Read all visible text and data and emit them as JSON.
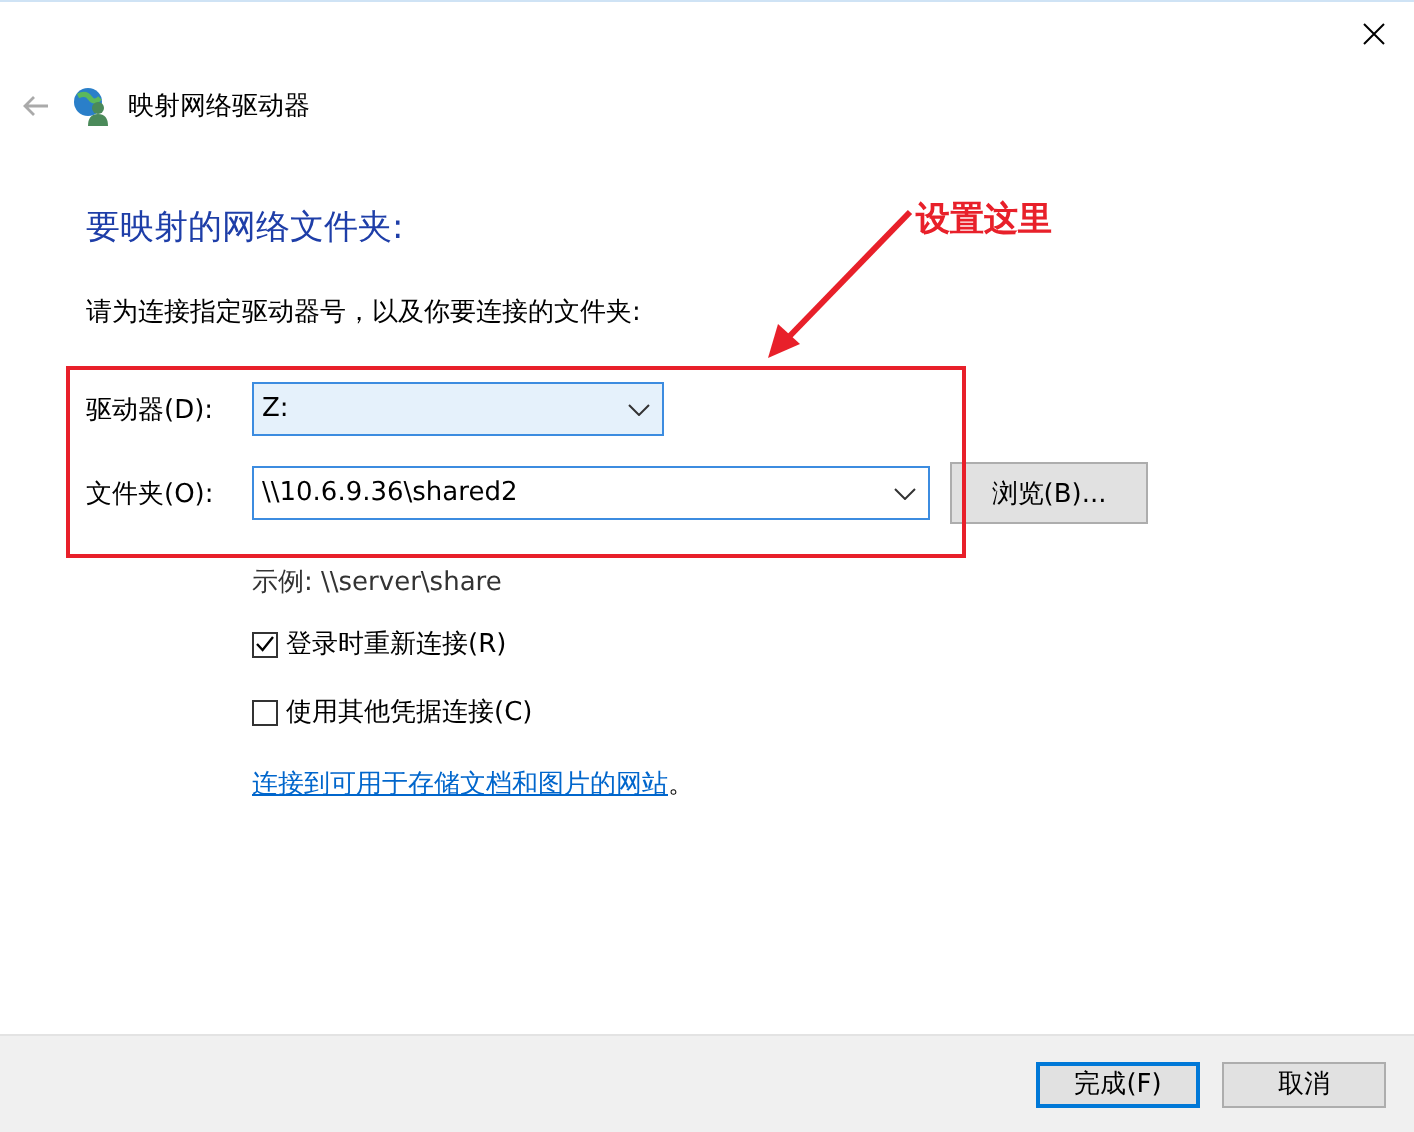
{
  "title": "映射网络驱动器",
  "heading": "要映射的网络文件夹:",
  "instruction": "请为连接指定驱动器号，以及你要连接的文件夹:",
  "fields": [
    {
      "label": "驱动器(D):",
      "value": "Z:",
      "highlighted": true,
      "wide": false
    },
    {
      "label": "文件夹(O):",
      "value": "\\\\10.6.9.36\\shared2",
      "highlighted": false,
      "wide": true
    }
  ],
  "browse_button": "浏览(B)...",
  "example": "示例: \\\\server\\share",
  "checkboxes": [
    {
      "label": "登录时重新连接(R)",
      "checked": true
    },
    {
      "label": "使用其他凭据连接(C)",
      "checked": false
    }
  ],
  "link": {
    "text": "连接到可用于存储文档和图片的网站",
    "suffix": "。"
  },
  "buttons": [
    {
      "label": "完成(F)",
      "default": true
    },
    {
      "label": "取消",
      "default": false
    }
  ],
  "annotation": {
    "text": "设置这里"
  }
}
